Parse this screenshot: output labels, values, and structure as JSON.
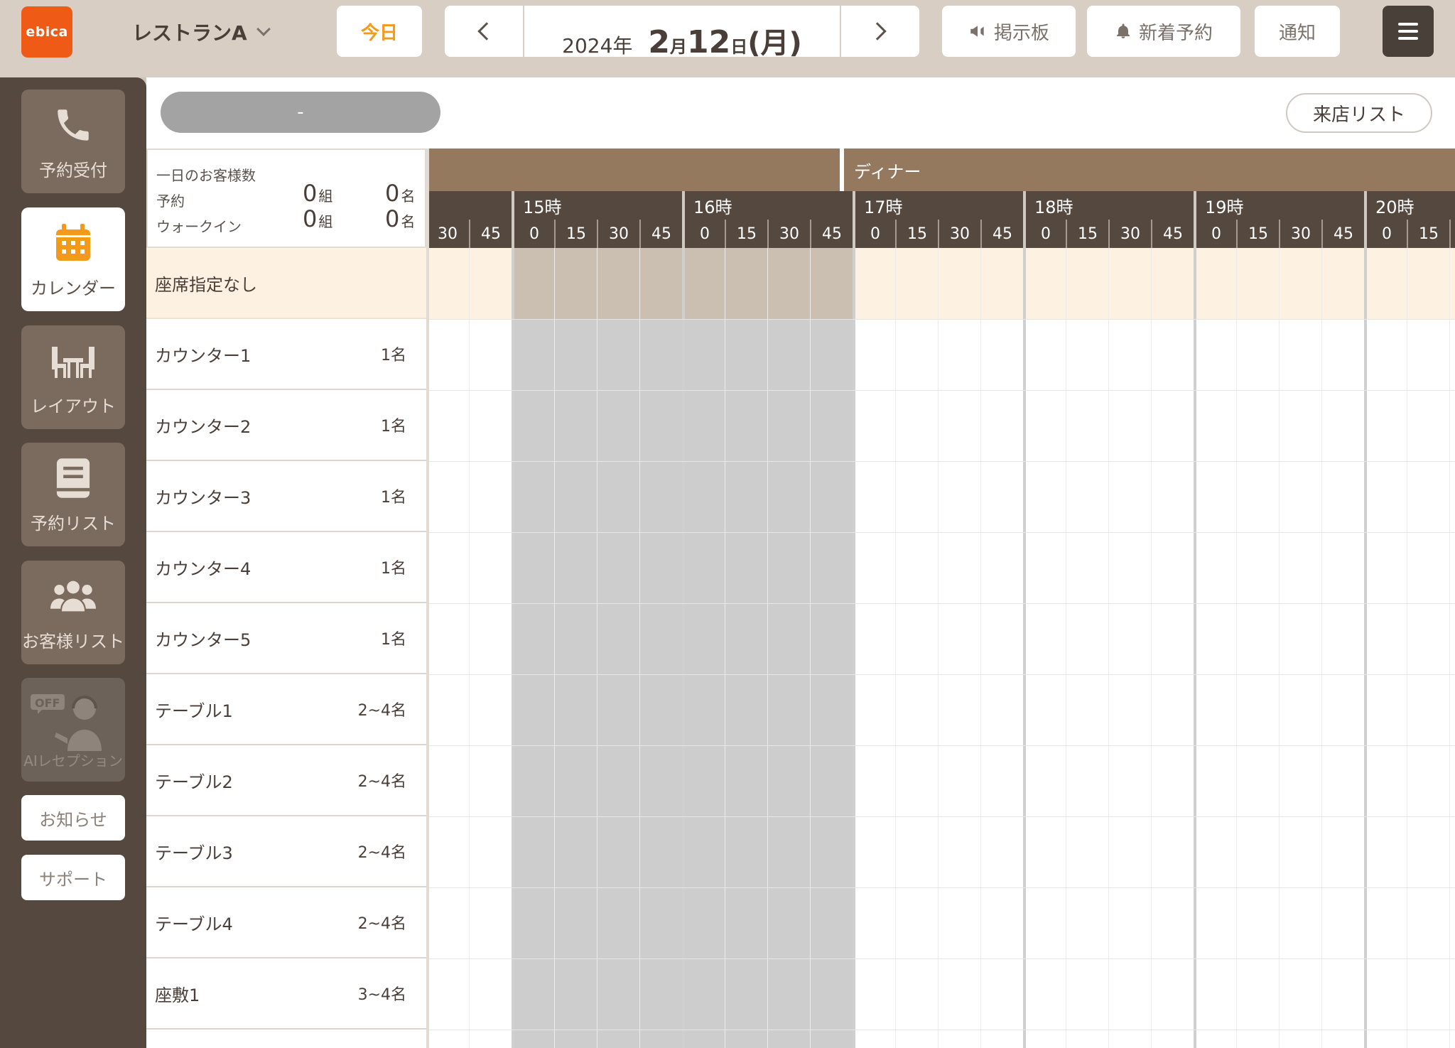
{
  "app": {
    "logo_text": "ebica",
    "store_name": "レストランA",
    "accent_color": "#ef5a17"
  },
  "topbar": {
    "today_label": "今日",
    "date": {
      "year": "2024年",
      "month": "2",
      "month_unit": "月",
      "day": "12",
      "day_unit": "日",
      "weekday": "(月)"
    },
    "board_label": "掲示板",
    "new_reservation_label": "新着予約",
    "notify_label": "通知"
  },
  "sidebar": {
    "items": [
      {
        "label": "予約受付",
        "icon": "phone-icon"
      },
      {
        "label": "カレンダー",
        "icon": "calendar-icon"
      },
      {
        "label": "レイアウト",
        "icon": "table-layout-icon"
      },
      {
        "label": "予約リスト",
        "icon": "book-icon"
      },
      {
        "label": "お客様リスト",
        "icon": "customers-icon"
      },
      {
        "label": "AIレセプション",
        "icon": "ai-reception-icon",
        "badge": "OFF"
      }
    ],
    "news_label": "お知らせ",
    "support_label": "サポート"
  },
  "main": {
    "status_pill": "-",
    "visitor_list_label": "来店リスト",
    "summary": {
      "title": "一日のお客様数",
      "reserve_label": "予約",
      "walkin_label": "ウォークイン",
      "reserve_groups": "0",
      "reserve_people": "0",
      "walkin_groups": "0",
      "walkin_people": "0",
      "group_unit": "組",
      "people_unit": "名"
    },
    "service_band": "ディナー",
    "hours": [
      "15時",
      "16時",
      "17時",
      "18時",
      "19時",
      "20時"
    ],
    "leading_minutes": [
      "30",
      "45"
    ],
    "minutes": [
      "0",
      "15",
      "30",
      "45"
    ],
    "seats": [
      {
        "name": "座席指定なし",
        "capacity": ""
      },
      {
        "name": "カウンター1",
        "capacity": "1名"
      },
      {
        "name": "カウンター2",
        "capacity": "1名"
      },
      {
        "name": "カウンター3",
        "capacity": "1名"
      },
      {
        "name": "カウンター4",
        "capacity": "1名"
      },
      {
        "name": "カウンター5",
        "capacity": "1名"
      },
      {
        "name": "テーブル1",
        "capacity": "2~4名"
      },
      {
        "name": "テーブル2",
        "capacity": "2~4名"
      },
      {
        "name": "テーブル3",
        "capacity": "2~4名"
      },
      {
        "name": "テーブル4",
        "capacity": "2~4名"
      },
      {
        "name": "座敷1",
        "capacity": "3~4名"
      }
    ]
  }
}
